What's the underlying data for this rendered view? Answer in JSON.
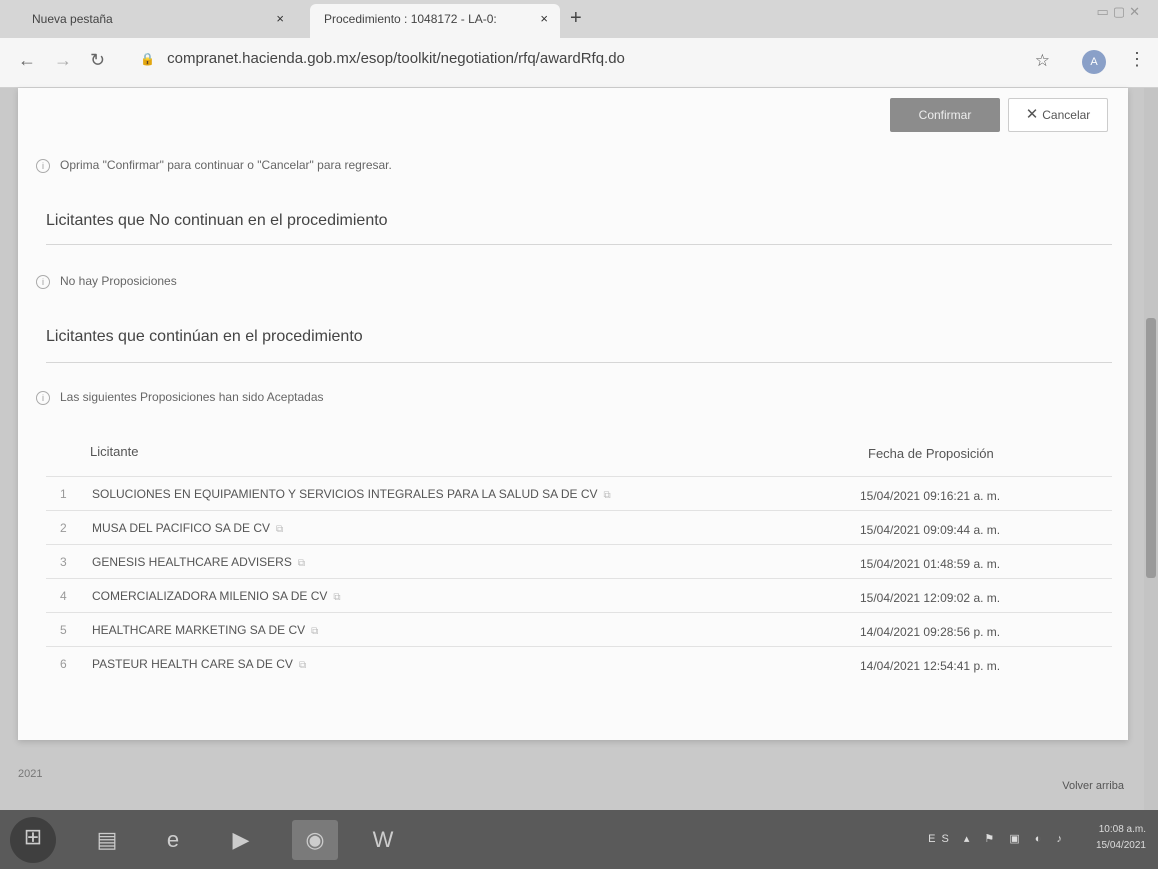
{
  "browser": {
    "tabs": [
      {
        "label": "Nueva pestaña",
        "close": "×"
      },
      {
        "label": "Procedimiento : 1048172 - LA-0:",
        "close": "×"
      }
    ],
    "new_tab": "+",
    "url": "compranet.hacienda.gob.mx/esop/toolkit/negotiation/rfq/awardRfq.do",
    "profile_initial": "A"
  },
  "modal": {
    "confirm_label": "Confirmar",
    "cancel_label": "Cancelar",
    "hint": "Oprima \"Confirmar\" para continuar o \"Cancelar\" para regresar.",
    "not_continuing": {
      "title": "Licitantes que No continuan en el procedimiento",
      "message": "No hay Proposiciones"
    },
    "continuing": {
      "title": "Licitantes que continúan en el procedimiento",
      "message": "Las siguientes Proposiciones han sido Aceptadas",
      "columns": {
        "licitante": "Licitante",
        "fecha": "Fecha de Proposición"
      },
      "rows": [
        {
          "num": "1",
          "name": "SOLUCIONES EN EQUIPAMIENTO Y SERVICIOS INTEGRALES PARA LA SALUD SA DE CV",
          "date": "15/04/2021 09:16:21 a. m."
        },
        {
          "num": "2",
          "name": "MUSA DEL PACIFICO SA DE CV",
          "date": "15/04/2021 09:09:44 a. m."
        },
        {
          "num": "3",
          "name": "GENESIS HEALTHCARE ADVISERS",
          "date": "15/04/2021 01:48:59 a. m."
        },
        {
          "num": "4",
          "name": "COMERCIALIZADORA MILENIO SA DE CV",
          "date": "15/04/2021 12:09:02 a. m."
        },
        {
          "num": "5",
          "name": "HEALTHCARE MARKETING SA DE CV",
          "date": "14/04/2021 09:28:56 p. m."
        },
        {
          "num": "6",
          "name": "PASTEUR HEALTH CARE SA DE CV",
          "date": "14/04/2021 12:54:41 p. m."
        }
      ]
    }
  },
  "page": {
    "footer_year": "2021",
    "back_to_top": "Volver arriba"
  },
  "taskbar": {
    "lang": "ES",
    "time": "10:08 a.m.",
    "date": "15/04/2021"
  }
}
